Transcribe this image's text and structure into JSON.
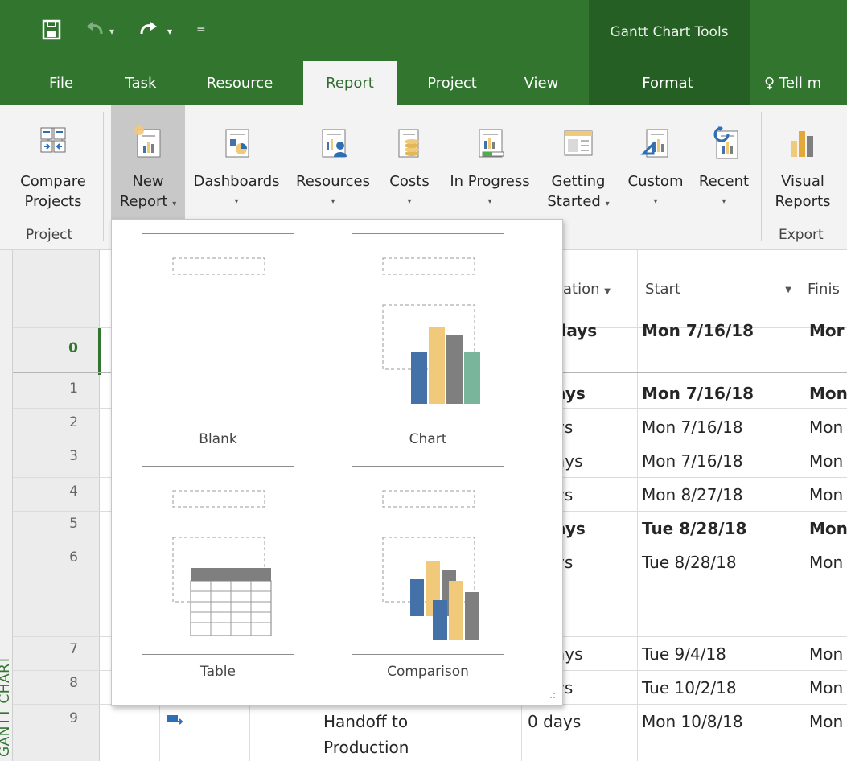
{
  "qat": {
    "save_icon": "save-icon",
    "undo_icon": "undo-icon",
    "redo_icon": "redo-icon",
    "customize_icon": "customize-icon"
  },
  "context": {
    "title": "Gantt Chart Tools"
  },
  "tabs": [
    {
      "label": "File"
    },
    {
      "label": "Task"
    },
    {
      "label": "Resource"
    },
    {
      "label": "Report"
    },
    {
      "label": "Project"
    },
    {
      "label": "View"
    },
    {
      "label": "Format"
    },
    {
      "label": "Tell m"
    }
  ],
  "ribbon": {
    "compare": {
      "line1": "Compare",
      "line2": "Projects"
    },
    "new_report": {
      "line1": "New",
      "line2": "Report"
    },
    "dashboards": {
      "line1": "Dashboards"
    },
    "resources": {
      "line1": "Resources"
    },
    "costs": {
      "line1": "Costs"
    },
    "in_progress": {
      "line1": "In Progress"
    },
    "getting_started": {
      "line1": "Getting",
      "line2": "Started"
    },
    "custom": {
      "line1": "Custom"
    },
    "recent": {
      "line1": "Recent"
    },
    "visual_reports": {
      "line1": "Visual",
      "line2": "Reports"
    },
    "groups": {
      "project": "Project",
      "export": "Export"
    },
    "colors": {
      "bar_blue": "#4472a8",
      "bar_gold": "#f0c97a",
      "bar_gray": "#7f7f7f",
      "accent_green": "#31752f"
    }
  },
  "grid": {
    "view_label": "GANTT CHART",
    "headers": {
      "duration": "ation",
      "start": "Start",
      "finish": "Finis"
    },
    "rows": [
      {
        "id": "0",
        "name": "",
        "duration": "days",
        "start": "Mon 7/16/18",
        "finish": "Mor",
        "bold": true
      },
      {
        "id": "1",
        "name": "",
        "duration": "ays",
        "start": "Mon 7/16/18",
        "finish": "Mon",
        "bold": true
      },
      {
        "id": "2",
        "name": "",
        "duration": "ys",
        "start": "Mon 7/16/18",
        "finish": "Mon",
        "bold": false
      },
      {
        "id": "3",
        "name": "",
        "duration": "ays",
        "start": "Mon 7/16/18",
        "finish": "Mon",
        "bold": false
      },
      {
        "id": "4",
        "name": "",
        "duration": "ys",
        "start": "Mon 8/27/18",
        "finish": "Mon",
        "bold": false
      },
      {
        "id": "5",
        "name": "",
        "duration": "ays",
        "start": "Tue 8/28/18",
        "finish": "Mon",
        "bold": true
      },
      {
        "id": "6",
        "name": "",
        "duration": "ys",
        "start": "Tue 8/28/18",
        "finish": "Mon",
        "bold": false
      },
      {
        "id": "7",
        "name": "",
        "duration": "ays",
        "start": "Tue 9/4/18",
        "finish": "Mon",
        "bold": false
      },
      {
        "id": "8",
        "name": "",
        "duration": "ys",
        "start": "Tue 10/2/18",
        "finish": "Mon",
        "bold": false
      },
      {
        "id": "9",
        "name_line1": "Handoff to",
        "name_line2": "Production",
        "duration": "0 days",
        "start": "Mon 10/8/18",
        "finish": "Mon",
        "bold": false
      }
    ]
  },
  "new_report_menu": {
    "items": [
      {
        "label": "Blank"
      },
      {
        "label": "Chart"
      },
      {
        "label": "Table"
      },
      {
        "label": "Comparison"
      }
    ]
  }
}
